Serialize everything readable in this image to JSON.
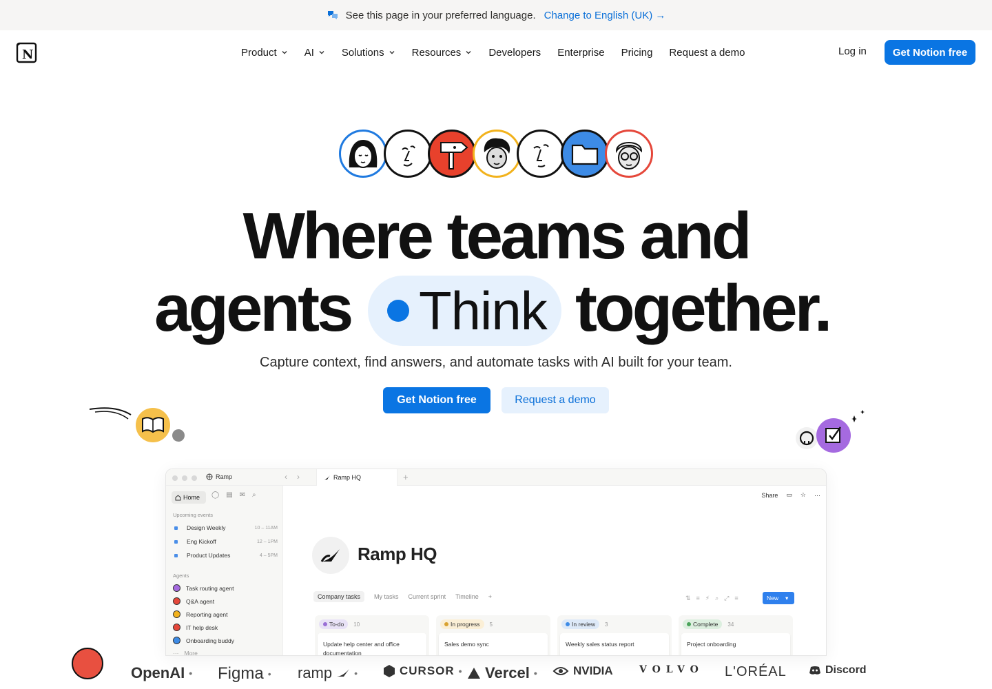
{
  "banner": {
    "text": "See this page in your preferred language.",
    "link": "Change to English (UK) →"
  },
  "nav": {
    "items": [
      {
        "label": "Product",
        "dropdown": true
      },
      {
        "label": "AI",
        "dropdown": true
      },
      {
        "label": "Solutions",
        "dropdown": true
      },
      {
        "label": "Resources",
        "dropdown": true
      },
      {
        "label": "Developers",
        "dropdown": false
      },
      {
        "label": "Enterprise",
        "dropdown": false
      },
      {
        "label": "Pricing",
        "dropdown": false
      },
      {
        "label": "Request a demo",
        "dropdown": false
      }
    ],
    "login": "Log in",
    "cta": "Get Notion free"
  },
  "hero": {
    "line1": "Where teams and",
    "line2_left": "agents",
    "pill_word": "Think",
    "line2_right": "together.",
    "subtitle": "Capture context, find answers, and automate tasks with AI built for your team.",
    "cta_primary": "Get Notion free",
    "cta_secondary": "Request a demo",
    "avatar_colors": [
      "#1f7ae0",
      "#111111",
      "#e8412c",
      "#f2b21c",
      "#111111",
      "#3d8be6",
      "#e5473a"
    ]
  },
  "app": {
    "workspace": "Ramp",
    "tab_title": "Ramp HQ",
    "home": "Home",
    "upcoming_label": "Upcoming events",
    "events": [
      {
        "name": "Design Weekly",
        "time": "10 – 11AM"
      },
      {
        "name": "Eng Kickoff",
        "time": "12 – 1PM"
      },
      {
        "name": "Product Updates",
        "time": "4 – 5PM"
      }
    ],
    "agents_label": "Agents",
    "agents": [
      {
        "name": "Task routing agent",
        "color": "#a56ae0"
      },
      {
        "name": "Q&A agent",
        "color": "#e5473a"
      },
      {
        "name": "Reporting agent",
        "color": "#f2b21c"
      },
      {
        "name": "IT help desk",
        "color": "#e5473a"
      },
      {
        "name": "Onboarding buddy",
        "color": "#3d8be6"
      },
      {
        "name": "More",
        "color": "#bbbbbb"
      }
    ],
    "share": "Share",
    "page_title": "Ramp HQ",
    "views": [
      "Company tasks",
      "My tasks",
      "Current sprint",
      "Timeline"
    ],
    "new_button": "New",
    "columns": [
      {
        "status": "To-do",
        "count": "10",
        "color": "#e8e2f6",
        "dot": "#9a6fd6",
        "card": "Update help center and office documentation"
      },
      {
        "status": "In progress",
        "count": "5",
        "color": "#fbefd6",
        "dot": "#d9a230",
        "card": "Sales demo sync"
      },
      {
        "status": "In review",
        "count": "3",
        "color": "#dde9f8",
        "dot": "#3d8be6",
        "card": "Weekly sales status report"
      },
      {
        "status": "Complete",
        "count": "34",
        "color": "#dcefdf",
        "dot": "#4aa35a",
        "card": "Project onboarding"
      }
    ]
  },
  "logos": [
    "OpenAI",
    "Figma",
    "ramp",
    "CURSOR",
    "Vercel",
    "NVIDIA",
    "VOLVO",
    "L'ORÉAL",
    "Discord"
  ],
  "colors": {
    "accent": "#0a75e3",
    "accent_light": "#e6f1fd"
  }
}
